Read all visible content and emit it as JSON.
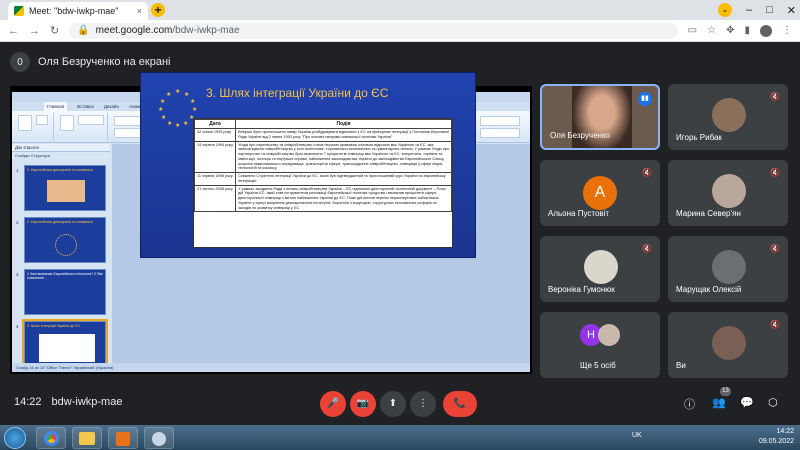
{
  "browser": {
    "tab_title": "Meet: \"bdw-iwkp-mae\"",
    "tab_close": "×",
    "new_tab": "+",
    "url_host": "meet.google.com",
    "url_path": "/bdw-iwkp-mae",
    "window": {
      "minimize": "–",
      "maximize": "□",
      "close": "✕",
      "tab_search": "⌄"
    }
  },
  "meet": {
    "presenting_count": "0",
    "presenting_label": "Оля Безрученко на екрані",
    "meeting_time": "14:22",
    "meeting_code": "bdw-iwkp-mae",
    "participants_badge": "13",
    "participants": [
      {
        "name": "Оля Безрученко",
        "speaking": true
      },
      {
        "name": "Игорь Рибак",
        "muted": true
      },
      {
        "name": "Альона Пустовіт",
        "letter": "А",
        "color": "#e8710a",
        "muted": true
      },
      {
        "name": "Марина Север'ян",
        "muted": true
      },
      {
        "name": "Вероніка Гумонюк",
        "muted": true
      },
      {
        "name": "Марущак Олексій",
        "muted": true
      },
      {
        "name": "Ще 5 осіб",
        "letter": "Н",
        "color": "#9334e6"
      },
      {
        "name": "Ви",
        "muted": true
      }
    ]
  },
  "powerpoint": {
    "title": "Дім Європи - Microsoft PowerPoint",
    "tabs": [
      "Главная",
      "Вставка",
      "Дизайн",
      "Анимация",
      "Показ слайдов",
      "Рецензирование",
      "Вид",
      "Office Tab"
    ],
    "outline_title": "Дім Європи",
    "outline_tabs": "Слайды  Структура",
    "thumbnails": [
      {
        "num": "1",
        "text": "2. Європейська демократія та символіка"
      },
      {
        "num": "2",
        "text": "2. Європейська демократія та символіка"
      },
      {
        "num": "3",
        "text": "1 Чим визначає Європейська спільнота? 2 Яке ставлення..."
      },
      {
        "num": "4",
        "text": "3. Шлях інтеграції України до ЄС"
      }
    ],
    "status": "Слайд 14 из 15   \"Office Theme\"   Украинский (Украина)",
    "slide": {
      "title": "3. Шлях інтеграції України до ЄС",
      "col_date": "Дата",
      "col_event": "Подія",
      "rows": [
        {
          "date": "02 липня 1993 року",
          "event": "Вперше було проголошено намір України розбудовувати відносини з ЄС на принципах інтеграції у Постанові Верховної Ради України від 2 липня 1993 року \"Про основні напрями зовнішньої політики України\""
        },
        {
          "date": "14 червня 1994 року",
          "event": "Угода про партнерство та співробітництво стала першою правовою основою відносин між Україною та ЄС, яка започаткувала співробітництво у колі політичних, торговельно-економічних та гуманітарних питань. У рамках Угоди про партнерство та співробітництво було визначено 7 пріоритетів співпраці між Україною та ЄС: енергетика, торгівля та інвестиції, юстиція та внутрішні справи, наближення законодавства України до законодавства Європейського Союзу, охорона навколишнього середовища, транспортна сфера, транскордонне співробітництво, співпраця у сфері науки, технологій та космосу"
        },
        {
          "date": "11 червня 1998 року",
          "event": "Схвалено Стратегію інтеграції України до ЄС, якою був підтверджений та проголошений курс України на європейську інтеграцію"
        },
        {
          "date": "21 лютого 2005 року",
          "event": "У рамках засідання Ради з питань співробітництва Україна – ЄС підписано двосторонній політичний документ – План дій Україна-ЄС, який став інструментом реалізації Європейської політики сусідства і визначив пріоритети сфери двосторонньої співпраці з метою наближення України до ЄС. План дій містив перелік першочергових зобов'язань України у сфері зміцнення демократичних інститутів, боротьби з корупцією, структурних економічних реформ та заходів по розвитку співпраці у ЄС"
        }
      ]
    }
  },
  "controls": {
    "mic": "🎤",
    "camera": "📷",
    "present": "⬆",
    "more": "⋮",
    "end": "📞",
    "info": "ⓘ",
    "people": "👥",
    "chat": "💬",
    "activities": "⬡"
  },
  "taskbar": {
    "lang": "UK",
    "time": "14:22",
    "date": "09.05.2022"
  },
  "colors": {
    "accent": "#8ab4f8",
    "end_call": "#ea4335",
    "slide_title": "#f6c343"
  }
}
